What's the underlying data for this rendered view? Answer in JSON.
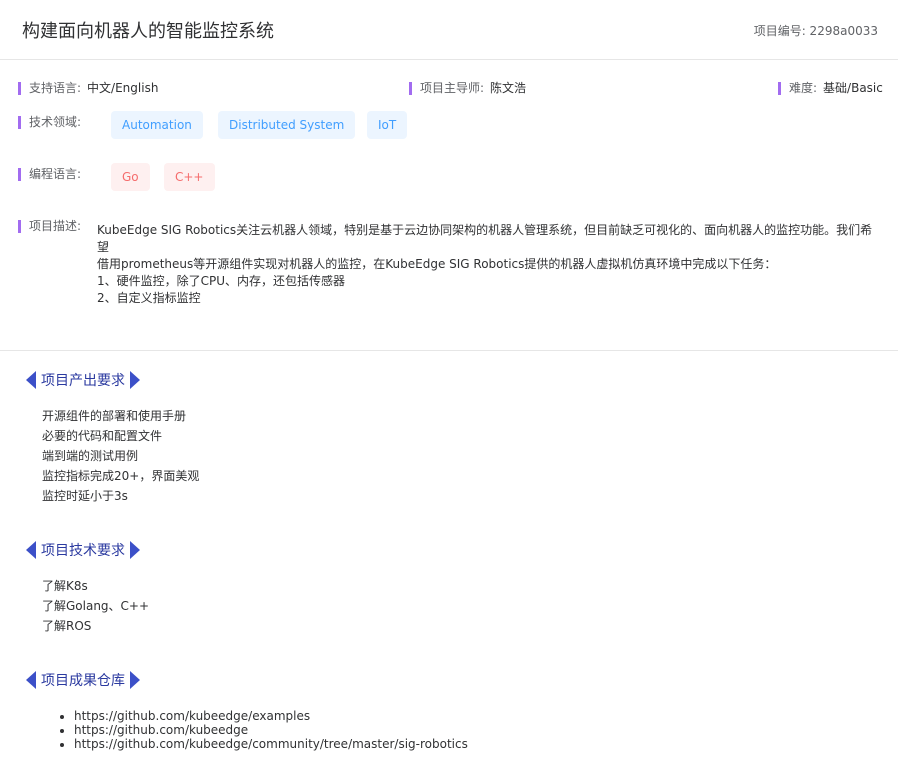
{
  "header": {
    "title": "构建面向机器人的智能监控系统",
    "project_no": "项目编号: 2298a0033"
  },
  "info": {
    "language_label": "支持语言:",
    "language_value": "中文/English",
    "mentor_label": "项目主导师:",
    "mentor_value": "陈文浩",
    "difficulty_label": "难度:",
    "difficulty_value": "基础/Basic",
    "tech_label": "技术领域:",
    "tech_tags": [
      "Automation",
      "Distributed System",
      "IoT"
    ],
    "prog_label": "编程语言:",
    "prog_tags": [
      "Go",
      "C++"
    ],
    "desc_label": "项目描述:",
    "desc_lines": [
      "KubeEdge SIG Robotics关注云机器人领域，特别是基于云边协同架构的机器人管理系统，但目前缺乏可视化的、面向机器人的监控功能。我们希望",
      "借用prometheus等开源组件实现对机器人的监控，在KubeEdge SIG Robotics提供的机器人虚拟机仿真环境中完成以下任务：",
      "1、硬件监控，除了CPU、内存，还包括传感器",
      "2、自定义指标监控"
    ]
  },
  "sections": {
    "output_title": "项目产出要求",
    "output_items": [
      "开源组件的部署和使用手册",
      "必要的代码和配置文件",
      "端到端的测试用例",
      "监控指标完成20+，界面美观",
      "监控时延小于3s"
    ],
    "tech_title": "项目技术要求",
    "tech_items": [
      "了解K8s",
      "了解Golang、C++",
      "了解ROS"
    ],
    "repo_title": "项目成果仓库",
    "repo_links": [
      "https://github.com/kubeedge/examples",
      "https://github.com/kubeedge",
      "https://github.com/kubeedge/community/tree/master/sig-robotics"
    ]
  }
}
